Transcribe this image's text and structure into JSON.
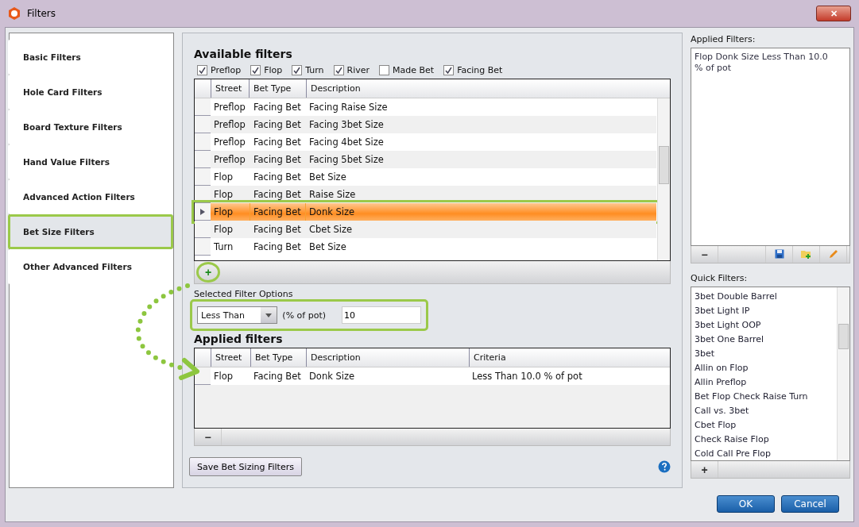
{
  "window": {
    "title": "Filters",
    "close": "✕"
  },
  "sidebar": {
    "items": [
      {
        "label": "Basic Filters",
        "selected": false
      },
      {
        "label": "Hole Card Filters",
        "selected": false
      },
      {
        "label": "Board Texture Filters",
        "selected": false
      },
      {
        "label": "Hand Value Filters",
        "selected": false
      },
      {
        "label": "Advanced Action Filters",
        "selected": false
      },
      {
        "label": "Bet Size Filters",
        "selected": true
      },
      {
        "label": "Other Advanced Filters",
        "selected": false
      }
    ]
  },
  "available_filters": {
    "title": "Available filters",
    "checkboxes": [
      {
        "label": "Preflop",
        "checked": true
      },
      {
        "label": "Flop",
        "checked": true
      },
      {
        "label": "Turn",
        "checked": true
      },
      {
        "label": "River",
        "checked": true
      },
      {
        "label": "Made Bet",
        "checked": false
      },
      {
        "label": "Facing Bet",
        "checked": true
      }
    ],
    "columns": [
      "Street",
      "Bet Type",
      "Description"
    ],
    "rows": [
      {
        "street": "Preflop",
        "bet_type": "Facing Bet",
        "description": "Facing Raise Size",
        "selected": false
      },
      {
        "street": "Preflop",
        "bet_type": "Facing Bet",
        "description": "Facing 3bet Size",
        "selected": false
      },
      {
        "street": "Preflop",
        "bet_type": "Facing Bet",
        "description": "Facing 4bet Size",
        "selected": false
      },
      {
        "street": "Preflop",
        "bet_type": "Facing Bet",
        "description": "Facing 5bet Size",
        "selected": false
      },
      {
        "street": "Flop",
        "bet_type": "Facing Bet",
        "description": "Bet Size",
        "selected": false
      },
      {
        "street": "Flop",
        "bet_type": "Facing Bet",
        "description": "Raise Size",
        "selected": false
      },
      {
        "street": "Flop",
        "bet_type": "Facing Bet",
        "description": "Donk Size",
        "selected": true
      },
      {
        "street": "Flop",
        "bet_type": "Facing Bet",
        "description": "Cbet Size",
        "selected": false
      },
      {
        "street": "Turn",
        "bet_type": "Facing Bet",
        "description": "Bet Size",
        "selected": false
      }
    ],
    "add_button": "+"
  },
  "selected_filter_options": {
    "label": "Selected Filter Options",
    "operator": "Less Than",
    "unit": "(% of pot)",
    "value": "10"
  },
  "applied_filters": {
    "title": "Applied filters",
    "columns": [
      "Street",
      "Bet Type",
      "Description",
      "Criteria"
    ],
    "rows": [
      {
        "street": "Flop",
        "bet_type": "Facing Bet",
        "description": "Donk Size",
        "criteria": "Less Than 10.0 % of pot"
      }
    ],
    "remove_button": "−"
  },
  "save_button": "Save Bet Sizing Filters",
  "applied_summary": {
    "label": "Applied Filters:",
    "text": "Flop Donk Size Less Than 10.0 % of pot",
    "remove_button": "−"
  },
  "quick_filters": {
    "label": "Quick Filters:",
    "items": [
      "3bet Double Barrel",
      "3bet Light IP",
      "3bet Light OOP",
      "3bet One Barrel",
      "3bet",
      "Allin on Flop",
      "Allin Preflop",
      "Bet Flop Check Raise Turn",
      "Call vs. 3bet",
      "Cbet Flop",
      "Check Raise Flop",
      "Cold Call Pre Flop"
    ],
    "add_button": "+"
  },
  "buttons": [
    {
      "label": "OK"
    },
    {
      "label": "Cancel"
    }
  ]
}
